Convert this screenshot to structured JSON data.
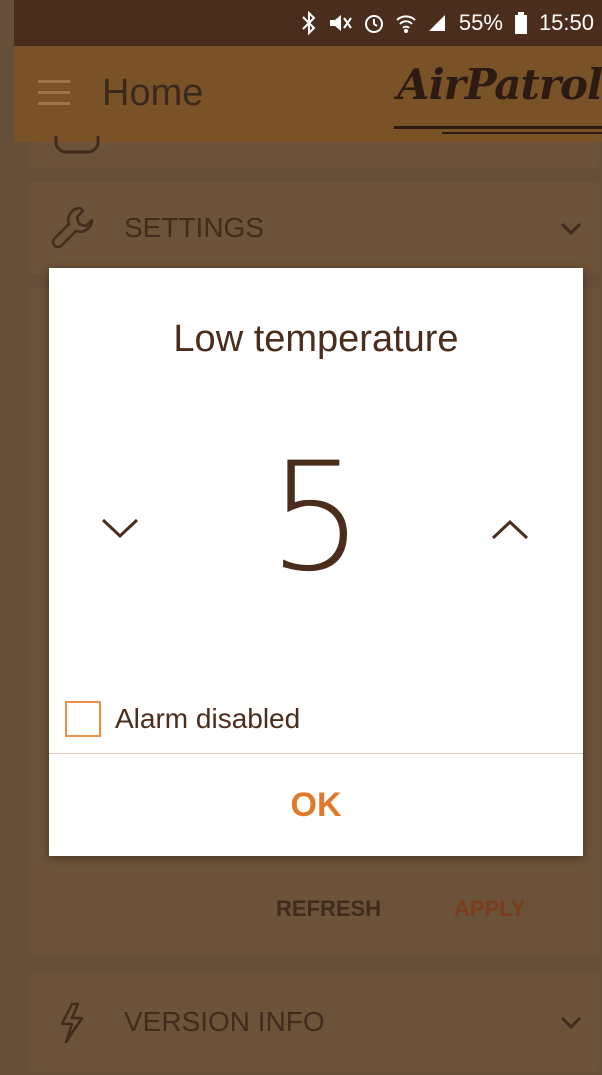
{
  "status_bar": {
    "battery": "55%",
    "time": "15:50",
    "icons": [
      "bluetooth-icon",
      "mute-icon",
      "alarm-icon",
      "wifi-icon",
      "signal-icon",
      "battery-icon"
    ]
  },
  "app_bar": {
    "title": "Home",
    "logo_text": "AirPatrol",
    "menu_icon": "hamburger-icon"
  },
  "sections": {
    "settings_label": "SETTINGS",
    "version_label": "VERSION INFO",
    "refresh_label": "REFRESH",
    "apply_label": "APPLY"
  },
  "dialog": {
    "title": "Low temperature",
    "value": "5",
    "decrease_icon": "chevron-down-icon",
    "increase_icon": "chevron-up-icon",
    "checkbox_label": "Alarm disabled",
    "checkbox_checked": false,
    "ok_label": "OK"
  },
  "colors": {
    "accent": "#e07a2a",
    "text_dark": "#4a2d1c",
    "status_bar": "#4a2d1c",
    "app_bar": "#7a5227",
    "background": "#664f38"
  }
}
